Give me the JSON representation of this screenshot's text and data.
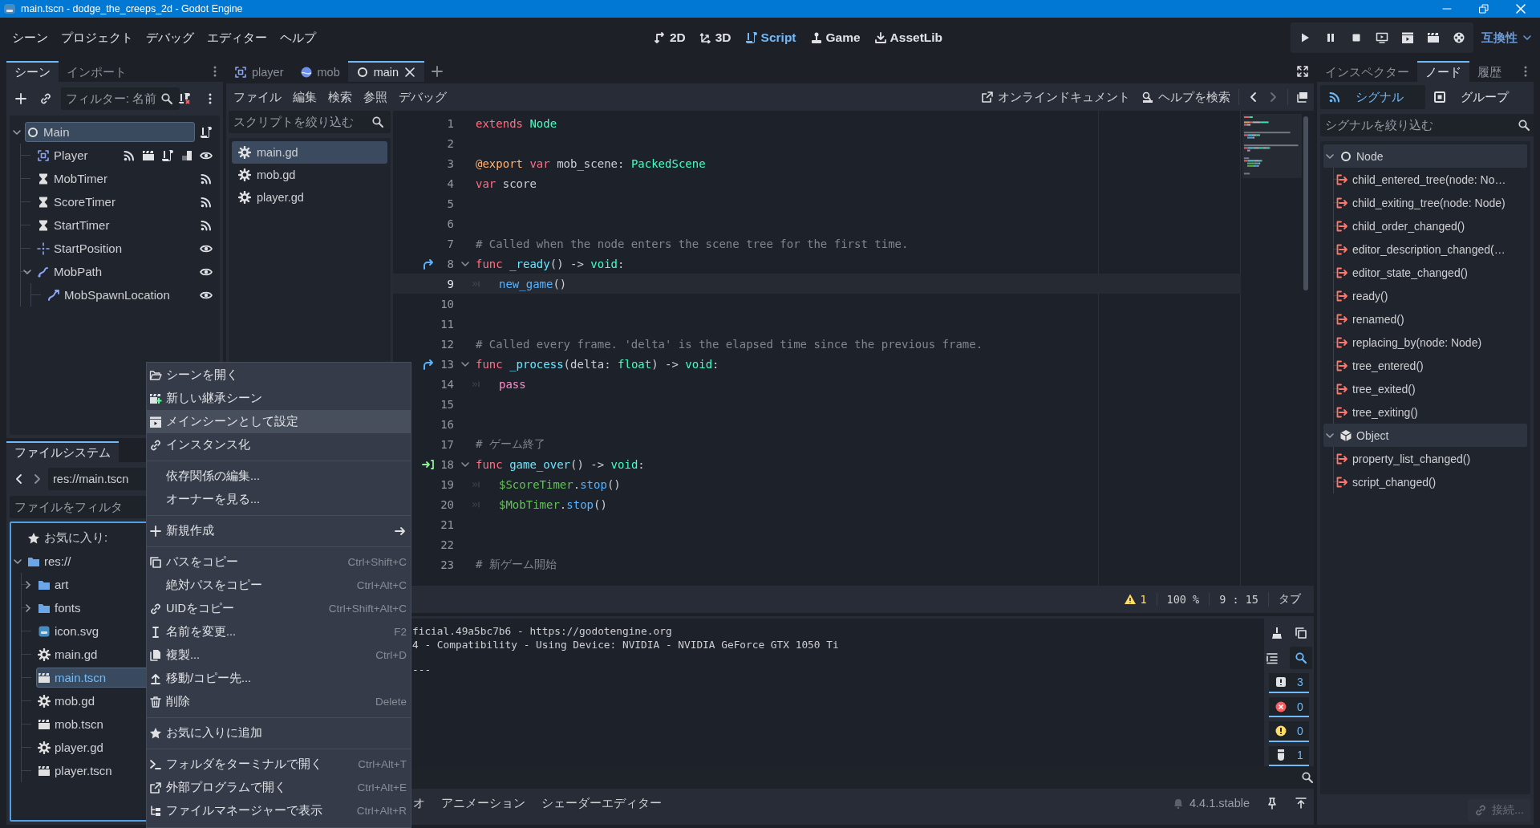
{
  "window": {
    "title": "main.tscn - dodge_the_creeps_2d - Godot Engine"
  },
  "menu": [
    "シーン",
    "プロジェクト",
    "デバッグ",
    "エディター",
    "ヘルプ"
  ],
  "main_screens": [
    {
      "kind": "canvas",
      "label": "2D",
      "selected": false
    },
    {
      "kind": "spatial",
      "label": "3D",
      "selected": false
    },
    {
      "kind": "script",
      "label": "Script",
      "selected": true
    },
    {
      "kind": "game",
      "label": "Game",
      "selected": false
    },
    {
      "kind": "assetlib",
      "label": "AssetLib",
      "selected": false
    }
  ],
  "renderer": "互換性",
  "scene_dock": {
    "tabs": [
      {
        "label": "シーン",
        "selected": true
      },
      {
        "label": "インポート",
        "selected": false
      }
    ],
    "filter": {
      "placeholder": "フィルター: 名前"
    },
    "tree": [
      {
        "name": "Main",
        "kind": "node",
        "selected": true,
        "expanded": true,
        "script": true,
        "children": [
          {
            "name": "Player",
            "kind": "area2d",
            "selected": false,
            "signals": true,
            "instance": true,
            "script": true,
            "groups": true,
            "visible": true
          },
          {
            "name": "MobTimer",
            "kind": "timer",
            "selected": false,
            "signals": true
          },
          {
            "name": "ScoreTimer",
            "kind": "timer",
            "selected": false,
            "signals": true
          },
          {
            "name": "StartTimer",
            "kind": "timer",
            "selected": false,
            "signals": true
          },
          {
            "name": "StartPosition",
            "kind": "marker",
            "selected": false,
            "visible": true
          },
          {
            "name": "MobPath",
            "kind": "path",
            "selected": false,
            "expanded": true,
            "visible": true,
            "children": [
              {
                "name": "MobSpawnLocation",
                "kind": "pathfollow",
                "selected": false,
                "visible": true
              }
            ]
          }
        ]
      }
    ]
  },
  "filesystem": {
    "tab": "ファイルシステム",
    "path": "res://main.tscn",
    "filter": {
      "placeholder": "ファイルをフィルタ"
    },
    "tree": [
      {
        "name": "お気に入り:",
        "kind": "favorites",
        "selected": false
      },
      {
        "name": "res://",
        "kind": "folder",
        "expanded": true,
        "selected": false,
        "children": [
          {
            "name": "art",
            "kind": "folder",
            "expanded": false,
            "selected": false
          },
          {
            "name": "fonts",
            "kind": "folder",
            "expanded": false,
            "selected": false
          },
          {
            "name": "icon.svg",
            "kind": "image",
            "selected": false
          },
          {
            "name": "main.gd",
            "kind": "script",
            "selected": false
          },
          {
            "name": "main.tscn",
            "kind": "scene",
            "selected": true
          },
          {
            "name": "mob.gd",
            "kind": "script",
            "selected": false
          },
          {
            "name": "mob.tscn",
            "kind": "scene",
            "selected": false
          },
          {
            "name": "player.gd",
            "kind": "script",
            "selected": false
          },
          {
            "name": "player.tscn",
            "kind": "scene",
            "selected": false
          }
        ]
      }
    ]
  },
  "script_editor": {
    "tabs": [
      {
        "label": "player",
        "kind": "area2d",
        "selected": false
      },
      {
        "label": "mob",
        "kind": "rigid",
        "selected": false
      },
      {
        "label": "main",
        "kind": "node",
        "selected": true
      }
    ],
    "menu": [
      "ファイル",
      "編集",
      "検索",
      "参照",
      "デバッグ"
    ],
    "online_docs": "オンラインドキュメント",
    "search_help": "ヘルプを検索",
    "script_filter": {
      "placeholder": "スクリプトを絞り込む"
    },
    "scripts": [
      {
        "name": "main.gd",
        "selected": true
      },
      {
        "name": "mob.gd",
        "selected": false
      },
      {
        "name": "player.gd",
        "selected": false
      }
    ],
    "code": [
      {
        "number": "1",
        "current": false,
        "tokens": [
          {
            "kind": "keyword",
            "text": "extends "
          },
          {
            "kind": "type",
            "text": "Node"
          }
        ]
      },
      {
        "number": "2",
        "current": false
      },
      {
        "number": "3",
        "current": false,
        "tokens": [
          {
            "kind": "annotation",
            "text": "@export "
          },
          {
            "kind": "keyword",
            "text": "var "
          },
          {
            "kind": "plain",
            "text": "mob_scene: "
          },
          {
            "kind": "type",
            "text": "PackedScene"
          }
        ]
      },
      {
        "number": "4",
        "current": false,
        "tokens": [
          {
            "kind": "keyword",
            "text": "var "
          },
          {
            "kind": "plain",
            "text": "score"
          }
        ]
      },
      {
        "number": "5",
        "current": false
      },
      {
        "number": "6",
        "current": false
      },
      {
        "number": "7",
        "current": false,
        "tokens": [
          {
            "kind": "comment",
            "text": "# Called when the node enters the scene tree for the first time."
          }
        ]
      },
      {
        "number": "8",
        "current": false,
        "overridden": true,
        "fold": true,
        "tokens": [
          {
            "kind": "keyword",
            "text": "func "
          },
          {
            "kind": "function",
            "text": "_ready"
          },
          {
            "kind": "plain",
            "text": "() -> "
          },
          {
            "kind": "type",
            "text": "void"
          },
          {
            "kind": "plain",
            "text": ":"
          }
        ]
      },
      {
        "number": "9",
        "current": true,
        "indent": true,
        "tokens": [
          {
            "kind": "call",
            "text": "new_game"
          },
          {
            "kind": "plain",
            "text": "()"
          }
        ]
      },
      {
        "number": "10",
        "current": false
      },
      {
        "number": "11",
        "current": false
      },
      {
        "number": "12",
        "current": false,
        "tokens": [
          {
            "kind": "comment",
            "text": "# Called every frame. 'delta' is the elapsed time since the previous frame."
          }
        ]
      },
      {
        "number": "13",
        "current": false,
        "overridden": true,
        "fold": true,
        "tokens": [
          {
            "kind": "keyword",
            "text": "func "
          },
          {
            "kind": "function",
            "text": "_process"
          },
          {
            "kind": "plain",
            "text": "(delta: "
          },
          {
            "kind": "type",
            "text": "float"
          },
          {
            "kind": "plain",
            "text": ") -> "
          },
          {
            "kind": "type",
            "text": "void"
          },
          {
            "kind": "plain",
            "text": ":"
          }
        ]
      },
      {
        "number": "14",
        "current": false,
        "indent": true,
        "tokens": [
          {
            "kind": "control",
            "text": "pass"
          }
        ]
      },
      {
        "number": "15",
        "current": false
      },
      {
        "number": "16",
        "current": false
      },
      {
        "number": "17",
        "current": false,
        "tokens": [
          {
            "kind": "comment",
            "text": "# ゲーム終了"
          }
        ]
      },
      {
        "number": "18",
        "current": false,
        "connected": true,
        "fold": true,
        "tokens": [
          {
            "kind": "keyword",
            "text": "func "
          },
          {
            "kind": "function",
            "text": "game_over"
          },
          {
            "kind": "plain",
            "text": "() -> "
          },
          {
            "kind": "type",
            "text": "void"
          },
          {
            "kind": "plain",
            "text": ":"
          }
        ]
      },
      {
        "number": "19",
        "current": false,
        "indent": true,
        "tokens": [
          {
            "kind": "nodepath",
            "text": "$ScoreTimer"
          },
          {
            "kind": "plain",
            "text": "."
          },
          {
            "kind": "call",
            "text": "stop"
          },
          {
            "kind": "plain",
            "text": "()"
          }
        ]
      },
      {
        "number": "20",
        "current": false,
        "indent": true,
        "tokens": [
          {
            "kind": "nodepath",
            "text": "$MobTimer"
          },
          {
            "kind": "plain",
            "text": "."
          },
          {
            "kind": "call",
            "text": "stop"
          },
          {
            "kind": "plain",
            "text": "()"
          }
        ]
      },
      {
        "number": "21",
        "current": false
      },
      {
        "number": "22",
        "current": false
      },
      {
        "number": "23",
        "current": false,
        "tokens": [
          {
            "kind": "comment",
            "text": "# 新ゲーム開始"
          }
        ]
      }
    ],
    "status": {
      "warnings": "1",
      "zoom": "100 %",
      "position": "9 : 15",
      "indent": "タブ"
    }
  },
  "bottom_panel": {
    "output": [
      "ficial.49a5bc7b6 - https://godotengine.org",
      "4 - Compatibility - Using Device: NVIDIA - NVIDIA GeForce GTX 1050 Ti",
      "---"
    ],
    "search_toggled": true,
    "filters": [
      {
        "kind": "message",
        "count": "3",
        "on": true
      },
      {
        "kind": "error",
        "count": "0",
        "on": true
      },
      {
        "kind": "warning",
        "count": "0",
        "on": true
      },
      {
        "kind": "editor",
        "count": "1",
        "on": true
      }
    ],
    "tabs": [
      "オ",
      "アニメーション",
      "シェーダーエディター"
    ],
    "version": "4.4.1.stable"
  },
  "node_dock": {
    "tabs": [
      {
        "label": "インスペクター",
        "selected": false
      },
      {
        "label": "ノード",
        "selected": true
      },
      {
        "label": "履歴",
        "selected": false
      }
    ],
    "subtabs": [
      {
        "label": "シグナル",
        "kind": "signals",
        "selected": true
      },
      {
        "label": "グループ",
        "kind": "groups",
        "selected": false
      }
    ],
    "filter": {
      "placeholder": "シグナルを絞り込む"
    },
    "classes": [
      {
        "name": "Node",
        "kind": "node",
        "expanded": true,
        "signals": [
          "child_entered_tree(node: No…",
          "child_exiting_tree(node: Node)",
          "child_order_changed()",
          "editor_description_changed(…",
          "editor_state_changed()",
          "ready()",
          "renamed()",
          "replacing_by(node: Node)",
          "tree_entered()",
          "tree_exited()",
          "tree_exiting()"
        ]
      },
      {
        "name": "Object",
        "kind": "object",
        "expanded": true,
        "signals": [
          "property_list_changed()",
          "script_changed()"
        ]
      }
    ],
    "connect_button": {
      "label": "接続...",
      "disabled": true
    }
  },
  "context_menu": [
    {
      "label": "シーンを開く",
      "kind": "open",
      "highlighted": false
    },
    {
      "label": "新しい継承シーン",
      "kind": "inherit",
      "highlighted": false
    },
    {
      "label": "メインシーンとして設定",
      "kind": "set-main",
      "highlighted": true
    },
    {
      "label": "インスタンス化",
      "kind": "instantiate",
      "highlighted": false
    },
    {
      "label": "依存関係の編集...",
      "kind": "plain",
      "highlighted": false,
      "separator_before": true
    },
    {
      "label": "オーナーを見る...",
      "kind": "plain",
      "highlighted": false
    },
    {
      "label": "新規作成",
      "kind": "new",
      "highlighted": false,
      "separator_before": true,
      "submenu": true
    },
    {
      "label": "パスをコピー",
      "kind": "copy-path",
      "highlighted": false,
      "separator_before": true,
      "shortcut": "Ctrl+Shift+C"
    },
    {
      "label": "絶対パスをコピー",
      "kind": "plain",
      "highlighted": false,
      "shortcut": "Ctrl+Alt+C"
    },
    {
      "label": "UIDをコピー",
      "kind": "copy-uid",
      "highlighted": false,
      "shortcut": "Ctrl+Shift+Alt+C"
    },
    {
      "label": "名前を変更...",
      "kind": "rename",
      "highlighted": false,
      "shortcut": "F2"
    },
    {
      "label": "複製...",
      "kind": "duplicate",
      "highlighted": false,
      "shortcut": "Ctrl+D"
    },
    {
      "label": "移動/コピー先...",
      "kind": "move",
      "highlighted": false
    },
    {
      "label": "削除",
      "kind": "delete",
      "highlighted": false,
      "shortcut": "Delete"
    },
    {
      "label": "お気に入りに追加",
      "kind": "favorite",
      "highlighted": false,
      "separator_before": true
    },
    {
      "label": "フォルダをターミナルで開く",
      "kind": "terminal",
      "highlighted": false,
      "separator_before": true,
      "shortcut": "Ctrl+Alt+T"
    },
    {
      "label": "外部プログラムで開く",
      "kind": "external",
      "highlighted": false,
      "shortcut": "Ctrl+Alt+E"
    },
    {
      "label": "ファイルマネージャーで表示",
      "kind": "file-manager",
      "highlighted": false,
      "shortcut": "Ctrl+Alt+R"
    }
  ]
}
